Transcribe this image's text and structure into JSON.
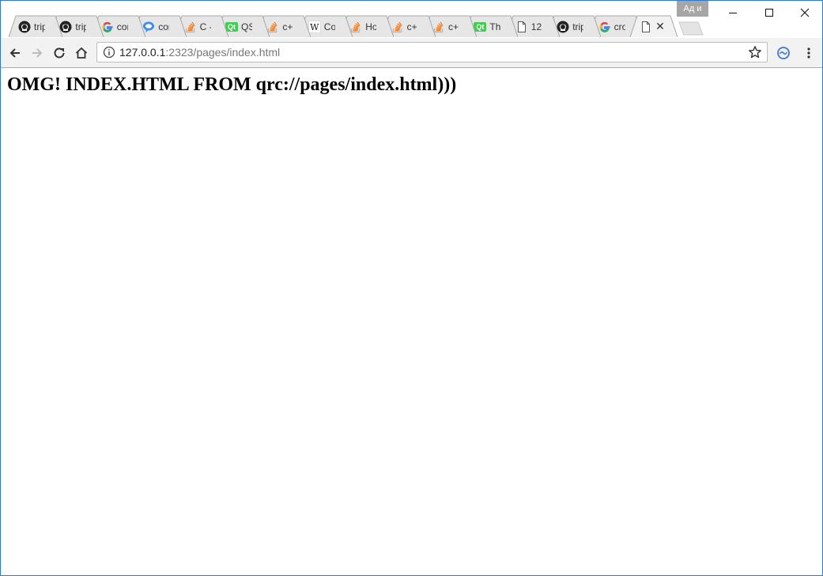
{
  "browser": {
    "profile_badge": "Ад и",
    "tabs": [
      {
        "icon": "github-icon",
        "title": "trip"
      },
      {
        "icon": "github-icon",
        "title": "trip"
      },
      {
        "icon": "google-icon",
        "title": "cor"
      },
      {
        "icon": "chat-bubble-icon",
        "title": "cor"
      },
      {
        "icon": "stackoverflow-icon",
        "title": "C -"
      },
      {
        "icon": "qt-icon",
        "title": "QS"
      },
      {
        "icon": "stackoverflow-icon",
        "title": "c+"
      },
      {
        "icon": "wikipedia-icon",
        "title": "Co"
      },
      {
        "icon": "stackoverflow-icon",
        "title": "Ho"
      },
      {
        "icon": "stackoverflow-icon",
        "title": "c+"
      },
      {
        "icon": "stackoverflow-icon",
        "title": "c+"
      },
      {
        "icon": "qt-icon",
        "title": "Th"
      },
      {
        "icon": "document-icon",
        "title": "12"
      },
      {
        "icon": "github-icon",
        "title": "trip"
      },
      {
        "icon": "google-icon",
        "title": "cro"
      },
      {
        "icon": "document-icon",
        "title": "",
        "active": true
      }
    ],
    "address": {
      "host": "127.0.0.1",
      "rest": ":2323/pages/index.html"
    },
    "colors": {
      "accent": "#2b79d0",
      "toolbar": "#f2f2f2",
      "stackoverflow": "#f48024",
      "qt": "#41cd52"
    }
  },
  "page": {
    "heading": "OMG! INDEX.HTML FROM qrc://pages/index.html)))"
  }
}
